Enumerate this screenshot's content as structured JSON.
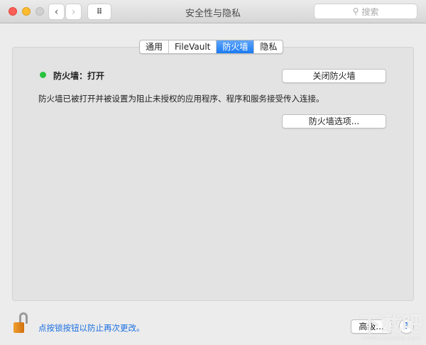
{
  "window": {
    "title": "安全性与隐私",
    "search_placeholder": "搜索"
  },
  "tabs": [
    {
      "label": "通用"
    },
    {
      "label": "FileVault"
    },
    {
      "label": "防火墙",
      "active": true
    },
    {
      "label": "隐私"
    }
  ],
  "firewall": {
    "status_label": "防火墙：打开",
    "status_color": "#2ac33f",
    "toggle_button": "关闭防火墙",
    "description": "防火墙已被打开并被设置为阻止未授权的应用程序、程序和服务接受传入连接。",
    "options_button": "防火墙选项..."
  },
  "footer": {
    "lock_text": "点按锁按钮以防止再次更改。",
    "advanced_button": "高级...",
    "help_button": "?"
  },
  "watermark": {
    "text": "下载吧",
    "url": "www.xiazaiba.com"
  }
}
